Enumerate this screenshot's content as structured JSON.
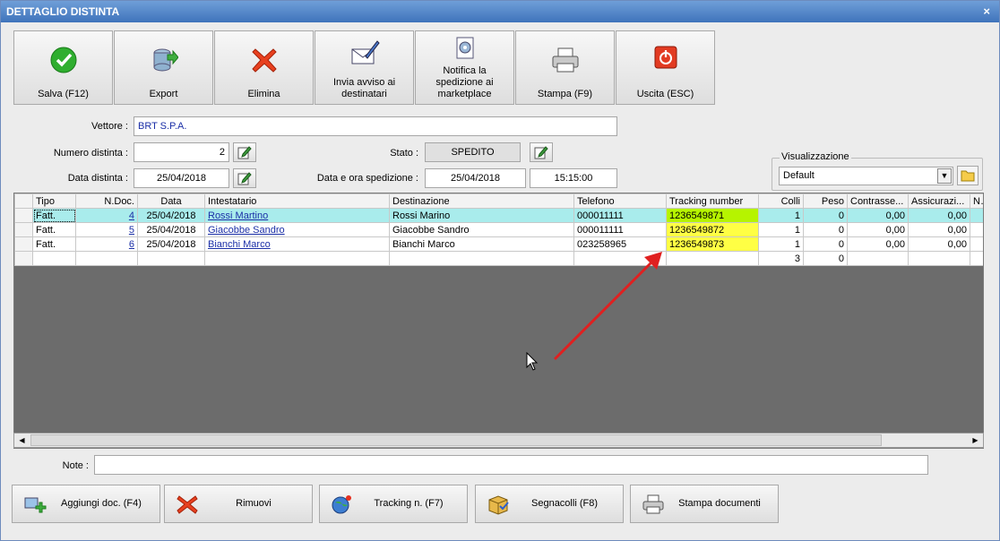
{
  "window": {
    "title": "DETTAGLIO DISTINTA",
    "close_glyph": "×"
  },
  "toolbar": [
    {
      "label": "Salva (F12)",
      "icon": "check-icon"
    },
    {
      "label": "Export",
      "icon": "database-export-icon"
    },
    {
      "label": "Elimina",
      "icon": "delete-x-icon"
    },
    {
      "label": "Invia avviso ai destinatari",
      "icon": "email-send-icon"
    },
    {
      "label": "Notifica la spedizione ai marketplace",
      "icon": "gear-document-icon"
    },
    {
      "label": "Stampa (F9)",
      "icon": "printer-icon"
    },
    {
      "label": "Uscita (ESC)",
      "icon": "power-icon"
    }
  ],
  "form": {
    "vettore_label": "Vettore :",
    "vettore_value": "BRT S.P.A.",
    "numero_label": "Numero distinta :",
    "numero_value": "2",
    "data_label": "Data distinta :",
    "data_value": "25/04/2018",
    "stato_label": "Stato :",
    "stato_value": "SPEDITO",
    "spedizione_label": "Data e ora spedizione :",
    "spedizione_date": "25/04/2018",
    "spedizione_time": "15:15:00"
  },
  "visualizzazione": {
    "legend": "Visualizzazione",
    "selected": "Default"
  },
  "grid": {
    "columns": [
      "Tipo",
      "N.Doc.",
      "Data",
      "Intestatario",
      "Destinazione",
      "Telefono",
      "Tracking number",
      "Colli",
      "Peso",
      "Contrasse...",
      "Assicurazi...",
      "No"
    ],
    "rows": [
      {
        "tipo": "Fatt.",
        "ndoc": "4",
        "data": "25/04/2018",
        "intestatario": "Rossi Martino",
        "destinazione": "Rossi Marino",
        "telefono": "000011111",
        "tracking": "1236549871",
        "colli": "1",
        "peso": "0",
        "contrassegno": "0,00",
        "assicurazione": "0,00"
      },
      {
        "tipo": "Fatt.",
        "ndoc": "5",
        "data": "25/04/2018",
        "intestatario": "Giacobbe Sandro",
        "destinazione": "Giacobbe Sandro",
        "telefono": "000011111",
        "tracking": "1236549872",
        "colli": "1",
        "peso": "0",
        "contrassegno": "0,00",
        "assicurazione": "0,00"
      },
      {
        "tipo": "Fatt.",
        "ndoc": "6",
        "data": "25/04/2018",
        "intestatario": "Bianchi Marco",
        "destinazione": "Bianchi Marco",
        "telefono": "023258965",
        "tracking": "1236549873",
        "colli": "1",
        "peso": "0",
        "contrassegno": "0,00",
        "assicurazione": "0,00"
      }
    ],
    "totals": {
      "colli": "3",
      "peso": "0"
    }
  },
  "note": {
    "label": "Note :",
    "value": ""
  },
  "bottom_buttons": [
    {
      "label": "Aggiungi doc. (F4)",
      "icon": "add-document-icon"
    },
    {
      "label": "Rimuovi",
      "icon": "remove-x-icon"
    },
    {
      "label": "Tracking n. (F7)",
      "icon": "globe-icon"
    },
    {
      "label": "Segnacolli (F8)",
      "icon": "package-icon"
    },
    {
      "label": "Stampa documenti",
      "icon": "printer-icon"
    }
  ],
  "colors": {
    "title_bar": "#3f73bb",
    "selected_row": "#a9ecec",
    "tracking_highlight": "#ffff44",
    "tracking_selected": "#b6f400",
    "annotation_arrow": "#e02020"
  }
}
